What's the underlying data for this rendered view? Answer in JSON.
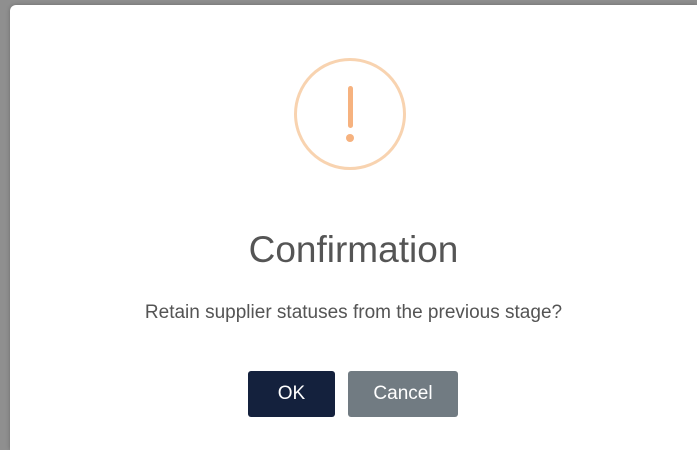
{
  "dialog": {
    "icon": "exclamation-warning-icon",
    "title": "Confirmation",
    "message": "Retain supplier statuses from the previous stage?",
    "ok_label": "OK",
    "cancel_label": "Cancel"
  },
  "colors": {
    "icon_ring": "#f8d3b0",
    "icon_mark": "#f6b27f",
    "ok_button": "#14213d",
    "cancel_button": "#717b82",
    "title_text": "#555555"
  }
}
